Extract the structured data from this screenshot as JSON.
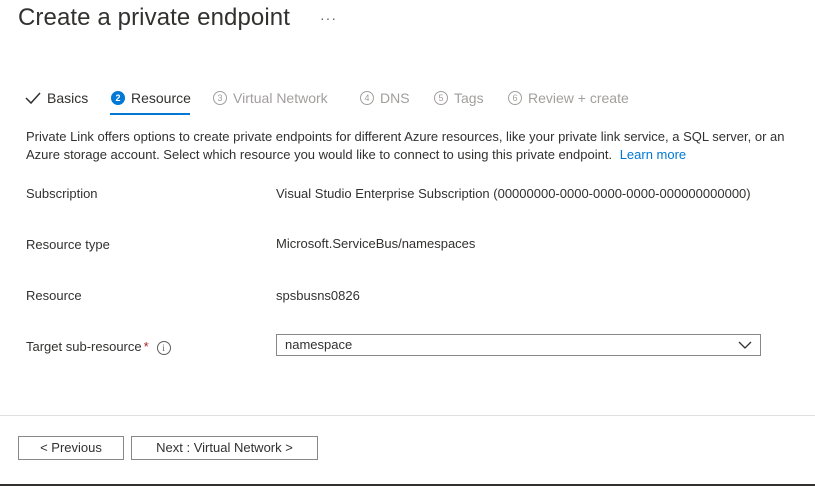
{
  "page": {
    "title": "Create a private endpoint",
    "more_label": "···"
  },
  "steps": [
    {
      "label": "Basics",
      "state": "done",
      "number": ""
    },
    {
      "label": "Resource",
      "state": "active",
      "number": "2"
    },
    {
      "label": "Virtual Network",
      "state": "disabled",
      "number": "3"
    },
    {
      "label": "DNS",
      "state": "disabled",
      "number": "4"
    },
    {
      "label": "Tags",
      "state": "disabled",
      "number": "5"
    },
    {
      "label": "Review + create",
      "state": "disabled",
      "number": "6"
    }
  ],
  "description": {
    "text": "Private Link offers options to create private endpoints for different Azure resources, like your private link service, a SQL server, or an Azure storage account. Select which resource you would like to connect to using this private endpoint.",
    "link": "Learn more"
  },
  "fields": {
    "subscription": {
      "label": "Subscription",
      "value": "Visual Studio Enterprise Subscription (00000000-0000-0000-0000-000000000000)"
    },
    "resource_type": {
      "label": "Resource type",
      "value": "Microsoft.ServiceBus/namespaces"
    },
    "resource": {
      "label": "Resource",
      "value": "spsbusns0826"
    },
    "target_sub_resource": {
      "label": "Target sub-resource",
      "required_mark": "*",
      "info_glyph": "i",
      "value": "namespace"
    }
  },
  "buttons": {
    "previous": "< Previous",
    "next": "Next : Virtual Network >"
  },
  "colors": {
    "accent": "#0078d4",
    "required": "#a4262c",
    "disabled_text": "#a19f9d"
  }
}
